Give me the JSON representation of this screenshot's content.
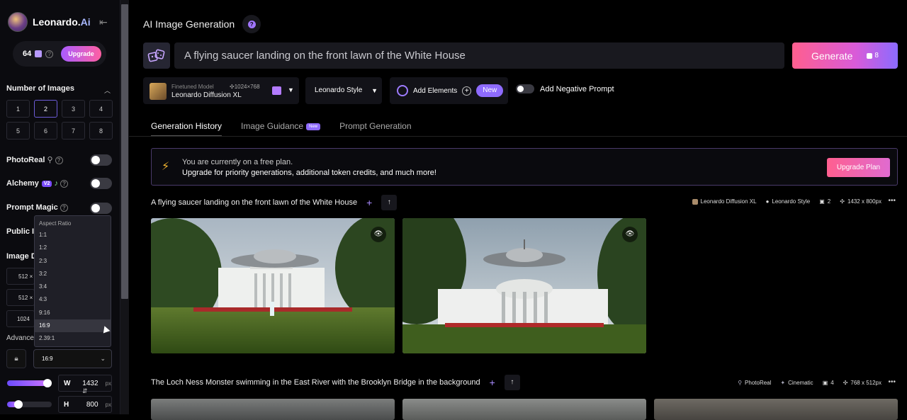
{
  "app": {
    "name_part1": "Leonardo.",
    "name_part2": "Ai"
  },
  "tokens": {
    "count": "64",
    "upgrade_label": "Upgrade"
  },
  "sidebar": {
    "number_of_images_label": "Number of Images",
    "image_counts": [
      "1",
      "2",
      "3",
      "4",
      "5",
      "6",
      "7",
      "8"
    ],
    "selected_count": "2",
    "photoreal_label": "PhotoReal",
    "alchemy_label": "Alchemy",
    "alchemy_badge": "V2",
    "prompt_magic_label": "Prompt Magic",
    "public_images_label": "Public I",
    "image_dimensions_label": "Image D",
    "dimensions": [
      "512 ×",
      "512 ×",
      "1024 ×"
    ],
    "advanced_label": "Advance",
    "aspect_ratio_value": "16:9",
    "width_label": "W",
    "width_value": "1432",
    "width_unit": "px",
    "height_label": "H",
    "height_value": "800",
    "height_unit": "px",
    "width_slider_fraction": 0.9,
    "height_slider_fraction": 0.25
  },
  "aspect_dropdown": {
    "header": "Aspect Ratio",
    "options": [
      "1:1",
      "1:2",
      "2:3",
      "3:2",
      "3:4",
      "4:3",
      "9:16",
      "16:9",
      "2.39:1"
    ],
    "highlighted": "16:9"
  },
  "header": {
    "title": "AI Image Generation",
    "help_icon": "?"
  },
  "prompt": {
    "text": "A flying saucer landing on the front lawn of the White House"
  },
  "generate": {
    "label": "Generate",
    "cost": "8"
  },
  "model": {
    "tag": "Finetuned Model",
    "size": "1024×768",
    "name": "Leonardo Diffusion XL"
  },
  "style": {
    "label": "Leonardo Style"
  },
  "elements": {
    "label": "Add Elements",
    "badge": "New"
  },
  "negative_prompt": {
    "label": "Add Negative Prompt"
  },
  "tabs": [
    {
      "label": "Generation History"
    },
    {
      "label": "Image Guidance",
      "badge": "New"
    },
    {
      "label": "Prompt Generation"
    }
  ],
  "banner": {
    "line1": "You are currently on a free plan.",
    "line2": "Upgrade for priority generations, additional token credits, and much more!",
    "button": "Upgrade Plan"
  },
  "generations": [
    {
      "prompt": "A flying saucer landing on the front lawn of the White House",
      "model": "Leonardo Diffusion XL",
      "style": "Leonardo Style",
      "count": "2",
      "size": "1432 x 800px"
    },
    {
      "prompt": "The Loch Ness Monster swimming in the East River with the Brooklyn Bridge in the background",
      "model": "PhotoReal",
      "style": "Cinematic",
      "count": "4",
      "size": "768 x 512px"
    }
  ],
  "colors": {
    "accent": "#8e6bff",
    "generate_start": "#ff5f8f",
    "generate_end": "#8b6bff",
    "bolt": "#f5b731"
  }
}
